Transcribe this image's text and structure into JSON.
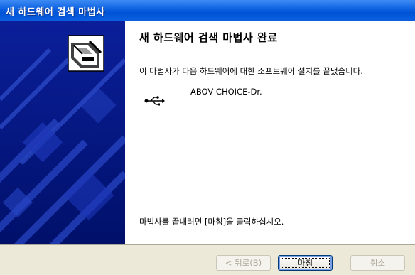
{
  "window": {
    "title": "새 하드웨어 검색 마법사"
  },
  "content": {
    "heading": "새 하드웨어 검색 마법사 완료",
    "description": "이 마법사가 다음 하드웨어에 대한 소프트웨어 설치를 끝냈습니다.",
    "device": {
      "icon": "usb-icon",
      "name": "ABOV CHOICE-Dr."
    },
    "finish_hint": "마법사를 끝내려면 [마침]을 클릭하십시오."
  },
  "buttons": {
    "back_label": "< 뒤로(B)",
    "finish_label": "마침",
    "cancel_label": "취소"
  },
  "colors": {
    "titlebar": "#0a5fe0",
    "side_panel": "#000080",
    "dialog_bg": "#ece9d8"
  }
}
